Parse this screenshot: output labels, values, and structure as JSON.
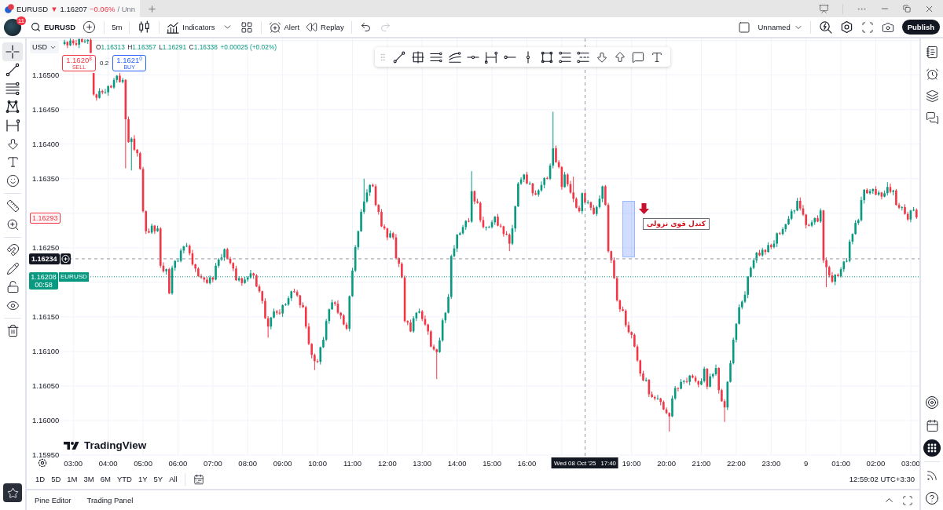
{
  "browser_tab": {
    "symbol": "EURUSD",
    "arrow": "▼",
    "price": "1.16207",
    "change": "−0.06%",
    "layout": "/ Unn"
  },
  "toolbar": {
    "badge": "11",
    "symbol": "EURUSD",
    "interval": "5m",
    "indicators": "Indicators",
    "alert": "Alert",
    "replay": "Replay",
    "undo": {
      "disabled": false
    },
    "redo": {
      "disabled": true
    },
    "layout_name": "Unnamed",
    "publish": "Publish"
  },
  "left_tools": [
    {
      "selected": true
    },
    {
      "selected": false
    },
    {
      "selected": false
    },
    {
      "selected": false
    },
    {
      "selected": false
    },
    {
      "selected": false
    },
    {
      "selected": false
    },
    {
      "selected": false
    },
    {
      "selected": false
    },
    {
      "selected": false
    },
    {
      "selected": false
    },
    {
      "selected": false
    },
    {
      "selected": false
    },
    {
      "selected": false
    },
    {
      "selected": false
    }
  ],
  "chart": {
    "currency": "USD",
    "legend": [
      {
        "label": "O",
        "value": "1.16313"
      },
      {
        "label": "H",
        "value": "1.16357"
      },
      {
        "label": "L",
        "value": "1.16291"
      },
      {
        "label": "C",
        "value": "1.16338"
      }
    ],
    "change": "+0.00025 (+0.02%)",
    "sell": {
      "price": "1.1620$^{8}$",
      "label": "SELL"
    },
    "spread": "0.2",
    "buy": {
      "price": "1.1621$^{0}$",
      "label": "BUY"
    },
    "chart_data": {
      "type": "candlestick",
      "grid": true,
      "ylim": [
        1.1595,
        1.16553
      ],
      "yticks": [
        {
          "value": 1.165,
          "label": "1.16500"
        },
        {
          "value": 1.1645,
          "label": "1.16450"
        },
        {
          "value": 1.164,
          "label": "1.16400"
        },
        {
          "value": 1.1635,
          "label": "1.16350"
        },
        {
          "value": 1.1625,
          "label": "1.16250"
        },
        {
          "value": 1.1615,
          "label": "1.16150"
        },
        {
          "value": 1.161,
          "label": "1.16100"
        },
        {
          "value": 1.1605,
          "label": "1.16050"
        },
        {
          "value": 1.16,
          "label": "1.16000"
        },
        {
          "value": 1.1595,
          "label": "1.15950"
        }
      ],
      "ref_lines": [
        {
          "axis": "y",
          "value": 1.16234,
          "color": "#9598a1"
        },
        {
          "axis": "y",
          "value": 1.16208,
          "color": "#089981"
        }
      ],
      "categories": [
        null,
        null,
        null,
        "03:00",
        null,
        null,
        null,
        null,
        null,
        null,
        null,
        null,
        null,
        null,
        null,
        "04:00",
        null,
        null,
        null,
        null,
        null,
        null,
        null,
        null,
        null,
        null,
        null,
        "05:00",
        null,
        null,
        null,
        null,
        null,
        null,
        null,
        null,
        null,
        null,
        null,
        "06:00",
        null,
        null,
        null,
        null,
        null,
        null,
        null,
        null,
        null,
        null,
        null,
        "07:00",
        null,
        null,
        null,
        null,
        null,
        null,
        null,
        null,
        null,
        null,
        null,
        "08:00",
        null,
        null,
        null,
        null,
        null,
        null,
        null,
        null,
        null,
        null,
        null,
        "09:00",
        null,
        null,
        null,
        null,
        null,
        null,
        null,
        null,
        null,
        null,
        null,
        "10:00",
        null,
        null,
        null,
        null,
        null,
        null,
        null,
        null,
        null,
        null,
        null,
        "11:00",
        null,
        null,
        null,
        null,
        null,
        null,
        null,
        null,
        null,
        null,
        null,
        "12:00",
        null,
        null,
        null,
        null,
        null,
        null,
        null,
        null,
        null,
        null,
        null,
        "13:00",
        null,
        null,
        null,
        null,
        null,
        null,
        null,
        null,
        null,
        null,
        null,
        "14:00",
        null,
        null,
        null,
        null,
        null,
        null,
        null,
        null,
        null,
        null,
        null,
        "15:00",
        null,
        null,
        null,
        null,
        null,
        null,
        null,
        null,
        null,
        null,
        null,
        "16:00",
        null,
        null,
        null,
        null,
        null,
        null,
        null,
        null,
        null,
        null,
        null,
        null,
        null,
        null,
        null,
        null,
        null,
        null,
        null,
        null,
        null,
        null,
        null,
        null,
        null,
        null,
        null,
        null,
        null,
        null,
        null,
        null,
        null,
        null,
        null,
        "19:00",
        null,
        null,
        null,
        null,
        null,
        null,
        null,
        null,
        null,
        null,
        null,
        "20:00",
        null,
        null,
        null,
        null,
        null,
        null,
        null,
        null,
        null,
        null,
        null,
        "21:00",
        null,
        null,
        null,
        null,
        null,
        null,
        null,
        null,
        null,
        null,
        null,
        "22:00",
        null,
        null,
        null,
        null,
        null,
        null,
        null,
        null,
        null,
        null,
        null,
        "23:00",
        null,
        null,
        null,
        null,
        null,
        null,
        null,
        null,
        null,
        null,
        null,
        "9",
        null,
        null,
        null,
        null,
        null,
        null,
        null,
        null,
        null,
        null,
        null,
        "01:00",
        null,
        null,
        null,
        null,
        null,
        null,
        null,
        null,
        null,
        null,
        null,
        "02:00",
        null,
        null,
        null,
        null,
        null,
        null,
        null,
        null,
        null,
        null,
        null,
        "03:00",
        null,
        null
      ],
      "ohlc": [
        [
          1.16545,
          1.16551,
          1.16543,
          1.16548
        ],
        [
          1.16548,
          1.16549,
          1.16539,
          1.16543
        ],
        [
          1.16543,
          1.16554,
          1.16542,
          1.1655
        ],
        [
          1.1655,
          1.16552,
          1.16543,
          1.16546
        ],
        [
          1.16546,
          1.16551,
          1.16542,
          1.16544
        ],
        [
          1.16544,
          1.16553,
          1.16539,
          1.16552
        ],
        [
          1.16552,
          1.16554,
          1.16547,
          1.16548
        ],
        [
          1.16548,
          1.16552,
          1.16546,
          1.16549
        ],
        [
          1.16549,
          1.16552,
          1.16545,
          1.16551
        ],
        [
          1.16551,
          1.16555,
          1.16532,
          1.16532
        ],
        [
          1.16503,
          1.16503,
          1.1647,
          1.16472
        ],
        [
          1.16472,
          1.16473,
          1.16463,
          1.16467
        ],
        [
          1.16467,
          1.16481,
          1.16466,
          1.16477
        ],
        [
          1.16477,
          1.16479,
          1.16472,
          1.16475
        ],
        [
          1.16475,
          1.1648,
          1.16473,
          1.16475
        ],
        [
          1.16475,
          1.16485,
          1.1647,
          1.16484
        ],
        [
          1.16484,
          1.16486,
          1.16481,
          1.16482
        ],
        [
          1.16482,
          1.16496,
          1.1648,
          1.16493
        ],
        [
          1.16493,
          1.165,
          1.16489,
          1.16499
        ],
        [
          1.16499,
          1.16503,
          1.16489,
          1.1649
        ],
        [
          1.1649,
          1.16496,
          1.16488,
          1.16493
        ],
        [
          1.16493,
          1.16494,
          1.16365,
          1.16436
        ],
        [
          1.16436,
          1.1644,
          1.16402,
          1.16403
        ],
        [
          1.16403,
          1.1641,
          1.16362,
          1.16408
        ],
        [
          1.16408,
          1.16413,
          1.1639,
          1.16392
        ],
        [
          1.16392,
          1.16393,
          1.16382,
          1.16387
        ],
        [
          1.16387,
          1.16389,
          1.16363,
          1.16364
        ],
        [
          1.16364,
          1.16367,
          1.16301,
          1.16303
        ],
        [
          1.16303,
          1.16304,
          1.1627,
          1.16274
        ],
        [
          1.16274,
          1.16278,
          1.16271,
          1.16272
        ],
        [
          1.16272,
          1.16285,
          1.1627,
          1.16282
        ],
        [
          1.16282,
          1.16283,
          1.1627,
          1.16274
        ],
        [
          1.16274,
          1.16282,
          1.16273,
          1.16278
        ],
        [
          1.16278,
          1.1628,
          1.16221,
          1.16224
        ],
        [
          1.16224,
          1.16229,
          1.16214,
          1.16216
        ],
        [
          1.16216,
          1.1622,
          1.16211,
          1.16219
        ],
        [
          1.16219,
          1.16221,
          1.16183,
          1.16184
        ],
        [
          1.16184,
          1.16224,
          1.16182,
          1.16221
        ],
        [
          1.16221,
          1.16232,
          1.16217,
          1.16231
        ],
        [
          1.16231,
          1.16235,
          1.1623,
          1.16231
        ],
        [
          1.16231,
          1.16249,
          1.16229,
          1.16246
        ],
        [
          1.16246,
          1.16253,
          1.16242,
          1.16252
        ],
        [
          1.16252,
          1.16257,
          1.16251,
          1.16253
        ],
        [
          1.16253,
          1.16255,
          1.16239,
          1.16242
        ],
        [
          1.16242,
          1.16247,
          1.16224,
          1.16226
        ],
        [
          1.16226,
          1.16227,
          1.16215,
          1.1622
        ],
        [
          1.1622,
          1.16222,
          1.16208,
          1.16209
        ],
        [
          1.16209,
          1.16212,
          1.16205,
          1.16207
        ],
        [
          1.16207,
          1.16208,
          1.162,
          1.16204
        ],
        [
          1.16204,
          1.16208,
          1.16198,
          1.16199
        ],
        [
          1.16199,
          1.1621,
          1.16197,
          1.16207
        ],
        [
          1.16207,
          1.16208,
          1.162,
          1.16204
        ],
        [
          1.16204,
          1.16228,
          1.16203,
          1.16224
        ],
        [
          1.16224,
          1.16235,
          1.16221,
          1.16233
        ],
        [
          1.16233,
          1.16241,
          1.16231,
          1.16236
        ],
        [
          1.16236,
          1.16249,
          1.16231,
          1.16248
        ],
        [
          1.16248,
          1.1625,
          1.16233,
          1.16234
        ],
        [
          1.16234,
          1.16237,
          1.16226,
          1.16228
        ],
        [
          1.16228,
          1.16229,
          1.16216,
          1.1622
        ],
        [
          1.1622,
          1.16224,
          1.16202,
          1.16203
        ],
        [
          1.16203,
          1.16209,
          1.16201,
          1.16206
        ],
        [
          1.16206,
          1.16207,
          1.16195,
          1.16199
        ],
        [
          1.16199,
          1.16208,
          1.16198,
          1.16204
        ],
        [
          1.16204,
          1.16209,
          1.16201,
          1.16207
        ],
        [
          1.16207,
          1.16218,
          1.16205,
          1.16213
        ],
        [
          1.16213,
          1.16214,
          1.16205,
          1.1621
        ],
        [
          1.1621,
          1.16212,
          1.16193,
          1.16194
        ],
        [
          1.16194,
          1.16197,
          1.16185,
          1.16187
        ],
        [
          1.16187,
          1.16188,
          1.16169,
          1.16173
        ],
        [
          1.16173,
          1.16177,
          1.16147,
          1.16148
        ],
        [
          1.16148,
          1.16151,
          1.1612,
          1.16136
        ],
        [
          1.16136,
          1.1615,
          1.16132,
          1.16149
        ],
        [
          1.16149,
          1.16162,
          1.16148,
          1.16158
        ],
        [
          1.16158,
          1.1616,
          1.16153,
          1.16156
        ],
        [
          1.16156,
          1.16161,
          1.16153,
          1.16155
        ],
        [
          1.16155,
          1.16168,
          1.1615,
          1.16167
        ],
        [
          1.16167,
          1.1617,
          1.16166,
          1.16168
        ],
        [
          1.16168,
          1.1618,
          1.16166,
          1.16177
        ],
        [
          1.16177,
          1.16188,
          1.16173,
          1.16187
        ],
        [
          1.16187,
          1.16191,
          1.16185,
          1.16186
        ],
        [
          1.16186,
          1.16189,
          1.16179,
          1.16181
        ],
        [
          1.16181,
          1.16182,
          1.16163,
          1.16167
        ],
        [
          1.16167,
          1.16171,
          1.16163,
          1.16164
        ],
        [
          1.16164,
          1.16166,
          1.16133,
          1.16136
        ],
        [
          1.16136,
          1.16141,
          1.16109,
          1.16111
        ],
        [
          1.16111,
          1.16112,
          1.1609,
          1.16095
        ],
        [
          1.16095,
          1.16097,
          1.16073,
          1.16086
        ],
        [
          1.16086,
          1.16089,
          1.16083,
          1.16085
        ],
        [
          1.16085,
          1.16107,
          1.16081,
          1.16106
        ],
        [
          1.16106,
          1.16121,
          1.16105,
          1.16117
        ],
        [
          1.16117,
          1.16147,
          1.16115,
          1.16144
        ],
        [
          1.16144,
          1.16162,
          1.1614,
          1.16161
        ],
        [
          1.16161,
          1.16175,
          1.1616,
          1.16171
        ],
        [
          1.16171,
          1.16173,
          1.16166,
          1.16169
        ],
        [
          1.16169,
          1.16174,
          1.16154,
          1.16156
        ],
        [
          1.16156,
          1.16157,
          1.16147,
          1.16152
        ],
        [
          1.16152,
          1.16154,
          1.16138,
          1.16139
        ],
        [
          1.16139,
          1.16142,
          1.16131,
          1.16133
        ],
        [
          1.16133,
          1.16181,
          1.16129,
          1.1618
        ],
        [
          1.1618,
          1.16221,
          1.16179,
          1.16217
        ],
        [
          1.16217,
          1.16254,
          1.16215,
          1.16251
        ],
        [
          1.16251,
          1.16275,
          1.16247,
          1.16274
        ],
        [
          1.16274,
          1.16306,
          1.16273,
          1.16302
        ],
        [
          1.16302,
          1.1635,
          1.16299,
          1.16317
        ],
        [
          1.16317,
          1.16335,
          1.16315,
          1.1633
        ],
        [
          1.1633,
          1.16342,
          1.16325,
          1.16341
        ],
        [
          1.16341,
          1.16343,
          1.16338,
          1.16339
        ],
        [
          1.16339,
          1.16342,
          1.1631,
          1.16312
        ],
        [
          1.16312,
          1.16313,
          1.16298,
          1.16302
        ],
        [
          1.16302,
          1.16306,
          1.1628,
          1.16281
        ],
        [
          1.16281,
          1.16284,
          1.16276,
          1.16278
        ],
        [
          1.16278,
          1.16279,
          1.16261,
          1.16265
        ],
        [
          1.16265,
          1.16275,
          1.16264,
          1.16271
        ],
        [
          1.16271,
          1.16273,
          1.16262,
          1.16265
        ],
        [
          1.16265,
          1.1627,
          1.16233,
          1.16235
        ],
        [
          1.16235,
          1.16236,
          1.16222,
          1.16227
        ],
        [
          1.16227,
          1.16229,
          1.16206,
          1.16207
        ],
        [
          1.16207,
          1.1621,
          1.16142,
          1.16144
        ],
        [
          1.16144,
          1.16145,
          1.16138,
          1.16142
        ],
        [
          1.16142,
          1.16146,
          1.16128,
          1.16129
        ],
        [
          1.16129,
          1.16151,
          1.16127,
          1.16148
        ],
        [
          1.16148,
          1.16157,
          1.16144,
          1.16156
        ],
        [
          1.16156,
          1.16162,
          1.16155,
          1.16158
        ],
        [
          1.16158,
          1.1616,
          1.16144,
          1.16147
        ],
        [
          1.16147,
          1.16152,
          1.16137,
          1.16139
        ],
        [
          1.16139,
          1.1614,
          1.16124,
          1.16129
        ],
        [
          1.16129,
          1.16131,
          1.16106,
          1.16107
        ],
        [
          1.16107,
          1.1611,
          1.16101,
          1.16103
        ],
        [
          1.16103,
          1.16104,
          1.1606,
          1.16099
        ],
        [
          1.16099,
          1.1612,
          1.16098,
          1.16116
        ],
        [
          1.16116,
          1.16148,
          1.16114,
          1.16145
        ],
        [
          1.16145,
          1.16157,
          1.16141,
          1.16156
        ],
        [
          1.16156,
          1.16183,
          1.16155,
          1.16179
        ],
        [
          1.16179,
          1.1624,
          1.16176,
          1.16238
        ],
        [
          1.16238,
          1.16254,
          1.16236,
          1.16249
        ],
        [
          1.16249,
          1.1627,
          1.16244,
          1.16269
        ],
        [
          1.16269,
          1.16273,
          1.16268,
          1.16271
        ],
        [
          1.16271,
          1.16283,
          1.16269,
          1.1628
        ],
        [
          1.1628,
          1.1629,
          1.16276,
          1.16289
        ],
        [
          1.16289,
          1.16293,
          1.16287,
          1.16288
        ],
        [
          1.16288,
          1.16361,
          1.16286,
          1.16332
        ],
        [
          1.16332,
          1.16333,
          1.16313,
          1.16317
        ],
        [
          1.16317,
          1.16321,
          1.16314,
          1.16315
        ],
        [
          1.16315,
          1.16317,
          1.16287,
          1.1629
        ],
        [
          1.1629,
          1.16295,
          1.16278,
          1.1628
        ],
        [
          1.1628,
          1.16281,
          1.16275,
          1.1628
        ],
        [
          1.1628,
          1.16282,
          1.16279,
          1.1628
        ],
        [
          1.1628,
          1.1629,
          1.16278,
          1.16287
        ],
        [
          1.16287,
          1.16296,
          1.16283,
          1.16295
        ],
        [
          1.16295,
          1.16299,
          1.16281,
          1.16282
        ],
        [
          1.16282,
          1.16285,
          1.16279,
          1.16281
        ],
        [
          1.16281,
          1.16282,
          1.16266,
          1.1627
        ],
        [
          1.1627,
          1.16274,
          1.16268,
          1.16269
        ],
        [
          1.16269,
          1.16271,
          1.16245,
          1.16256
        ],
        [
          1.16256,
          1.16283,
          1.16254,
          1.16278
        ],
        [
          1.16278,
          1.16311,
          1.16273,
          1.1631
        ],
        [
          1.1631,
          1.16345,
          1.16309,
          1.16343
        ],
        [
          1.16343,
          1.16352,
          1.16341,
          1.16349
        ],
        [
          1.16349,
          1.16357,
          1.16345,
          1.16356
        ],
        [
          1.16356,
          1.1636,
          1.16342,
          1.16343
        ],
        [
          1.16343,
          1.16346,
          1.16341,
          1.16343
        ],
        [
          1.16343,
          1.16344,
          1.16325,
          1.16329
        ],
        [
          1.16329,
          1.16333,
          1.16326,
          1.16327
        ],
        [
          1.16327,
          1.16335,
          1.16324,
          1.16333
        ],
        [
          1.16333,
          1.16346,
          1.16331,
          1.16341
        ],
        [
          1.16341,
          1.16352,
          1.16336,
          1.16351
        ],
        [
          1.16351,
          1.16353,
          1.16349,
          1.1635
        ],
        [
          1.1635,
          1.16372,
          1.16348,
          1.16369
        ],
        [
          1.16369,
          1.16447,
          1.16365,
          1.16394
        ],
        [
          1.16394,
          1.16398,
          1.16373,
          1.16374
        ],
        [
          1.16374,
          1.16377,
          1.16365,
          1.16367
        ],
        [
          1.16367,
          1.16368,
          1.16334,
          1.16338
        ],
        [
          1.16338,
          1.1636,
          1.16337,
          1.16356
        ],
        [
          1.16356,
          1.16358,
          1.16339,
          1.16342
        ],
        [
          1.16342,
          1.16347,
          1.16328,
          1.1633
        ],
        [
          1.1633,
          1.16353,
          1.16316,
          1.16321
        ],
        [
          1.16321,
          1.16323,
          1.16307,
          1.16308
        ],
        [
          1.16308,
          1.16311,
          1.16301,
          1.16303
        ],
        [
          1.16303,
          1.1633,
          1.16299,
          1.16329
        ],
        [
          1.16329,
          1.16333,
          1.16314,
          1.16315
        ],
        [
          1.16315,
          1.16319,
          1.16313,
          1.16316
        ],
        [
          1.16316,
          1.16317,
          1.16304,
          1.16308
        ],
        [
          1.16308,
          1.16312,
          1.16298,
          1.16299
        ],
        [
          1.16299,
          1.16311,
          1.16296,
          1.16309
        ],
        [
          1.16309,
          1.16326,
          1.16307,
          1.16321
        ],
        [
          1.16321,
          1.1634,
          1.16316,
          1.16339
        ],
        [
          1.16339,
          1.16341,
          1.16311,
          1.16312
        ],
        [
          1.16312,
          1.16315,
          1.16243,
          1.16245
        ],
        [
          1.16245,
          1.16246,
          1.16228,
          1.16232
        ],
        [
          1.16232,
          1.16236,
          1.16205,
          1.16206
        ],
        [
          1.16206,
          1.16209,
          1.16172,
          1.16174
        ],
        [
          1.16174,
          1.16175,
          1.16157,
          1.16161
        ],
        [
          1.16161,
          1.16165,
          1.16158,
          1.16159
        ],
        [
          1.16159,
          1.16161,
          1.16135,
          1.16138
        ],
        [
          1.16138,
          1.16143,
          1.16126,
          1.16128
        ],
        [
          1.16128,
          1.16129,
          1.16119,
          1.16124
        ],
        [
          1.16124,
          1.16126,
          1.16106,
          1.16107
        ],
        [
          1.16107,
          1.1611,
          1.16085,
          1.16087
        ],
        [
          1.16087,
          1.16088,
          1.16064,
          1.16068
        ],
        [
          1.16068,
          1.16072,
          1.16057,
          1.16058
        ],
        [
          1.16058,
          1.16062,
          1.16056,
          1.16059
        ],
        [
          1.16059,
          1.1606,
          1.16034,
          1.16038
        ],
        [
          1.16038,
          1.16042,
          1.16033,
          1.16034
        ],
        [
          1.16034,
          1.16036,
          1.16029,
          1.16032
        ],
        [
          1.16032,
          1.16037,
          1.1603,
          1.16032
        ],
        [
          1.16032,
          1.16033,
          1.16022,
          1.16027
        ],
        [
          1.16027,
          1.16029,
          1.16015,
          1.16016
        ],
        [
          1.16016,
          1.16019,
          1.16009,
          1.16011
        ],
        [
          1.16011,
          1.16012,
          1.15984,
          1.16006
        ],
        [
          1.16006,
          1.16036,
          1.16005,
          1.16032
        ],
        [
          1.16032,
          1.1605,
          1.1603,
          1.16047
        ],
        [
          1.16047,
          1.16048,
          1.16042,
          1.16046
        ],
        [
          1.16046,
          1.1606,
          1.16045,
          1.16056
        ],
        [
          1.16056,
          1.16059,
          1.16053,
          1.16057
        ],
        [
          1.16057,
          1.16062,
          1.16054,
          1.16056
        ],
        [
          1.16056,
          1.16066,
          1.16051,
          1.16065
        ],
        [
          1.16065,
          1.16067,
          1.16061,
          1.16062
        ],
        [
          1.16062,
          1.16065,
          1.16055,
          1.16057
        ],
        [
          1.16057,
          1.16058,
          1.16048,
          1.16052
        ],
        [
          1.16052,
          1.16061,
          1.16051,
          1.16057
        ],
        [
          1.16057,
          1.16078,
          1.16055,
          1.16075
        ],
        [
          1.16075,
          1.16076,
          1.16045,
          1.16049
        ],
        [
          1.16049,
          1.16068,
          1.16048,
          1.16064
        ],
        [
          1.16064,
          1.16069,
          1.16061,
          1.16067
        ],
        [
          1.16067,
          1.16081,
          1.16065,
          1.16076
        ],
        [
          1.16076,
          1.16077,
          1.16039,
          1.16044
        ],
        [
          1.16044,
          1.16046,
          1.16027,
          1.16028
        ],
        [
          1.16028,
          1.16031,
          1.15998,
          1.16019
        ],
        [
          1.16019,
          1.16057,
          1.16015,
          1.16056
        ],
        [
          1.16056,
          1.16087,
          1.16055,
          1.16083
        ],
        [
          1.16083,
          1.1612,
          1.16081,
          1.16117
        ],
        [
          1.16117,
          1.16141,
          1.16113,
          1.1614
        ],
        [
          1.1614,
          1.16168,
          1.16139,
          1.16164
        ],
        [
          1.16164,
          1.16174,
          1.16161,
          1.16172
        ],
        [
          1.16172,
          1.16187,
          1.1617,
          1.16182
        ],
        [
          1.16182,
          1.16209,
          1.16177,
          1.16208
        ],
        [
          1.16208,
          1.16223,
          1.16207,
          1.16221
        ],
        [
          1.16221,
          1.16235,
          1.16219,
          1.16232
        ],
        [
          1.16232,
          1.16244,
          1.16228,
          1.16243
        ],
        [
          1.16243,
          1.16247,
          1.16238,
          1.16239
        ],
        [
          1.16239,
          1.1625,
          1.16237,
          1.16247
        ],
        [
          1.16247,
          1.16248,
          1.1624,
          1.16244
        ],
        [
          1.16244,
          1.16258,
          1.16243,
          1.16254
        ],
        [
          1.16254,
          1.16256,
          1.16248,
          1.16251
        ],
        [
          1.16251,
          1.16261,
          1.16249,
          1.16256
        ],
        [
          1.16256,
          1.16272,
          1.16251,
          1.16271
        ],
        [
          1.16271,
          1.16273,
          1.16269,
          1.1627
        ],
        [
          1.1627,
          1.1628,
          1.16268,
          1.16277
        ],
        [
          1.16277,
          1.16285,
          1.16273,
          1.16284
        ],
        [
          1.16284,
          1.16296,
          1.16283,
          1.16292
        ],
        [
          1.16292,
          1.16306,
          1.1629,
          1.16303
        ],
        [
          1.16303,
          1.16305,
          1.16299,
          1.16304
        ],
        [
          1.16304,
          1.16322,
          1.16303,
          1.16318
        ],
        [
          1.16318,
          1.16323,
          1.16304,
          1.16307
        ],
        [
          1.16307,
          1.16312,
          1.16296,
          1.16298
        ],
        [
          1.16298,
          1.16299,
          1.16278,
          1.16283
        ],
        [
          1.16283,
          1.16285,
          1.16281,
          1.16282
        ],
        [
          1.16282,
          1.1629,
          1.1628,
          1.16287
        ],
        [
          1.16287,
          1.16294,
          1.16283,
          1.16293
        ],
        [
          1.16293,
          1.16297,
          1.16287,
          1.16288
        ],
        [
          1.16288,
          1.16307,
          1.16286,
          1.16304
        ],
        [
          1.16304,
          1.16305,
          1.16228,
          1.16232
        ],
        [
          1.16232,
          1.16236,
          1.16193,
          1.16222
        ],
        [
          1.16222,
          1.16224,
          1.16207,
          1.1621
        ],
        [
          1.1621,
          1.16215,
          1.16199,
          1.16201
        ],
        [
          1.16201,
          1.16212,
          1.16196,
          1.16211
        ],
        [
          1.16211,
          1.16213,
          1.16208,
          1.16209
        ],
        [
          1.16209,
          1.16222,
          1.16207,
          1.16219
        ],
        [
          1.16219,
          1.16231,
          1.16215,
          1.1623
        ],
        [
          1.1623,
          1.16235,
          1.16229,
          1.16231
        ],
        [
          1.16231,
          1.16262,
          1.16229,
          1.16259
        ],
        [
          1.16259,
          1.16271,
          1.16255,
          1.1627
        ],
        [
          1.1627,
          1.1629,
          1.16269,
          1.16286
        ],
        [
          1.16286,
          1.16292,
          1.16283,
          1.1629
        ],
        [
          1.1629,
          1.16324,
          1.16288,
          1.16319
        ],
        [
          1.16319,
          1.16335,
          1.16314,
          1.16334
        ],
        [
          1.16334,
          1.16336,
          1.16328,
          1.16329
        ],
        [
          1.16329,
          1.16335,
          1.16327,
          1.16332
        ],
        [
          1.16332,
          1.16336,
          1.16328,
          1.16335
        ],
        [
          1.16335,
          1.16339,
          1.16326,
          1.16327
        ],
        [
          1.16327,
          1.16333,
          1.16325,
          1.1633
        ],
        [
          1.1633,
          1.16331,
          1.1632,
          1.16324
        ],
        [
          1.16324,
          1.16333,
          1.16323,
          1.16329
        ],
        [
          1.16329,
          1.16345,
          1.16326,
          1.16338
        ],
        [
          1.16338,
          1.16343,
          1.16329,
          1.16331
        ],
        [
          1.16331,
          1.16334,
          1.16326,
          1.16333
        ],
        [
          1.16333,
          1.16335,
          1.16311,
          1.16312
        ],
        [
          1.16312,
          1.16315,
          1.16306,
          1.16308
        ],
        [
          1.16308,
          1.1631,
          1.16304,
          1.16309
        ],
        [
          1.16309,
          1.16313,
          1.16298,
          1.16299
        ],
        [
          1.16299,
          1.16302,
          1.16289,
          1.16291
        ],
        [
          1.16291,
          1.16305,
          1.16287,
          1.16304
        ],
        [
          1.16304,
          1.16309,
          1.16303,
          1.16305
        ],
        [
          1.16305,
          1.16307,
          1.16292,
          1.16294
        ]
      ]
    },
    "price_labels": [
      {
        "kind": "marker",
        "price": "1.16293"
      },
      {
        "kind": "crosshair",
        "price": "1.16234"
      },
      {
        "kind": "last",
        "price": "1.16208",
        "countdown": "00:58",
        "symbol": "EURUSD"
      }
    ],
    "crosshair_time": {
      "date": "Wed 08 Oct '25",
      "time": "17:40"
    },
    "note": "کندل قوی نزولی",
    "branding": "TradingView"
  },
  "range_bar": {
    "ranges": [
      "1D",
      "5D",
      "1M",
      "3M",
      "6M",
      "YTD",
      "1Y",
      "5Y",
      "All"
    ],
    "clock": "12:59:02 UTC+3:30"
  },
  "bottom_panel": {
    "tabs": [
      "Pine Editor",
      "Trading Panel"
    ]
  }
}
